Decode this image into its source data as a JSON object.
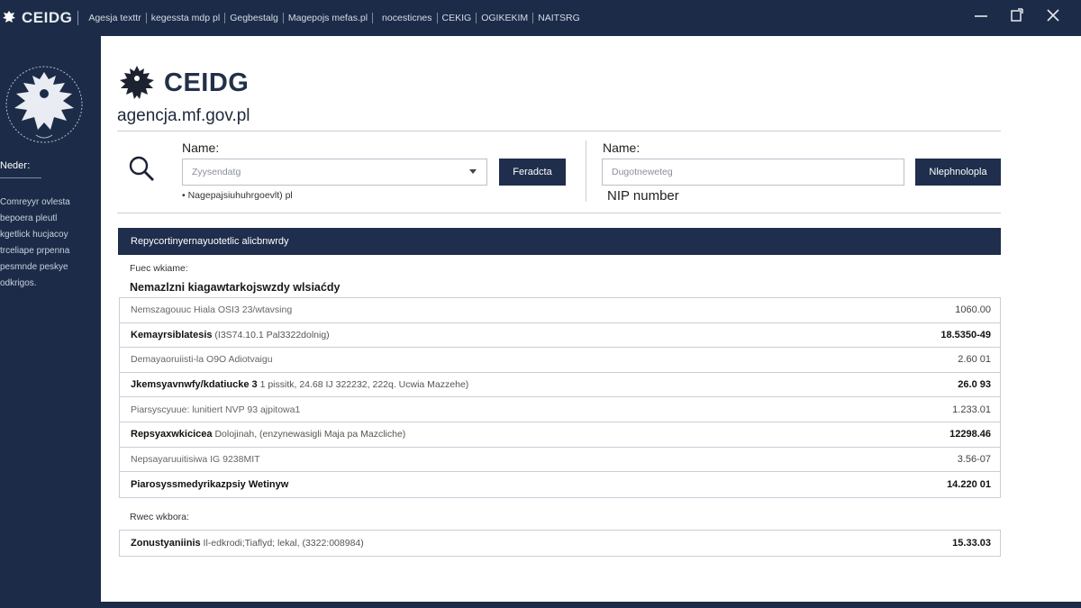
{
  "topbar": {
    "brand": "CEIDG",
    "nav": [
      "Agesja texttr",
      "kegessta mdp pl",
      "Gegbestalg",
      "Magepojs mefas.pl",
      "nocesticnes",
      "CEKIG",
      "OGIKEKIM",
      "NAITSRG"
    ]
  },
  "sidebar": {
    "nav_title": "Nedeг:",
    "links": [
      "Comreyyr ovlesta",
      "bepoera pleutl",
      "kgetlick hucjacoy",
      "trceliape prpenna",
      "pesmnde peskye",
      "odkrigos."
    ]
  },
  "main": {
    "logo_title": "CEIDG",
    "domain": "agencja.mf.gov.pl",
    "search": {
      "name_label": "Name:",
      "placeholder": "Zyysendatg",
      "button": "Feradcta",
      "hint": "•  Nagepajsiuhuhrgoevlt) pl"
    },
    "nip": {
      "name_label": "Name:",
      "placeholder": "Dugotneweteg",
      "button": "Nlephnolopla",
      "nip_label": "NIP number"
    },
    "section_header": "Repycortinyernayuotetlic alicbnwrdy",
    "caption1": "Fuec wkiame:",
    "subtitle": "Nemazlzni kiagawtarkojswzdy wlsiaćdy",
    "rows": [
      {
        "label": "",
        "desc": "Nemszagouuc Hiala OSI3 23/wtavsing",
        "value": "1060.00",
        "bold": false
      },
      {
        "label": "Kemayrsiblatesis",
        "desc": "(I3S74.10.1 Pal3322dolnig)",
        "value": "18.5350-49",
        "bold": true
      },
      {
        "label": "",
        "desc": "Demayaoruiisti-la O9O Adiotvaigu",
        "value": "2.60 01",
        "bold": false
      },
      {
        "label": "Jkemsyavnwfy/kdatiucke 3",
        "desc": "1 pissitk, 24.68 IJ 322232, 222q. Ucwia Mazzehe)",
        "value": "26.0 93",
        "bold": true
      },
      {
        "label": "",
        "desc": "Piarsyscyuue: lunitiert NVP 93 ajpitowa1",
        "value": "1.233.01",
        "bold": false
      },
      {
        "label": "Repsyaxwkicicea",
        "desc": "Dolojinah, (enzynewasigli Maja pa Mazcliche)",
        "value": "12298.46",
        "bold": true
      },
      {
        "label": "",
        "desc": "Nepsayaruuitisiwa IG 9238MIT",
        "value": "3.56-07",
        "bold": false
      },
      {
        "label": "Piarosyssmedyrikazpsiy Wetinyw",
        "desc": "",
        "value": "14.220 01",
        "bold": true
      }
    ],
    "caption2": "Rwec wkbora:",
    "final_row": {
      "label": "Zonustyaniinis",
      "desc": "Il-edkrodi;Tiaflyd; lekal, (3322:008984)",
      "value": "15.33.03"
    }
  }
}
